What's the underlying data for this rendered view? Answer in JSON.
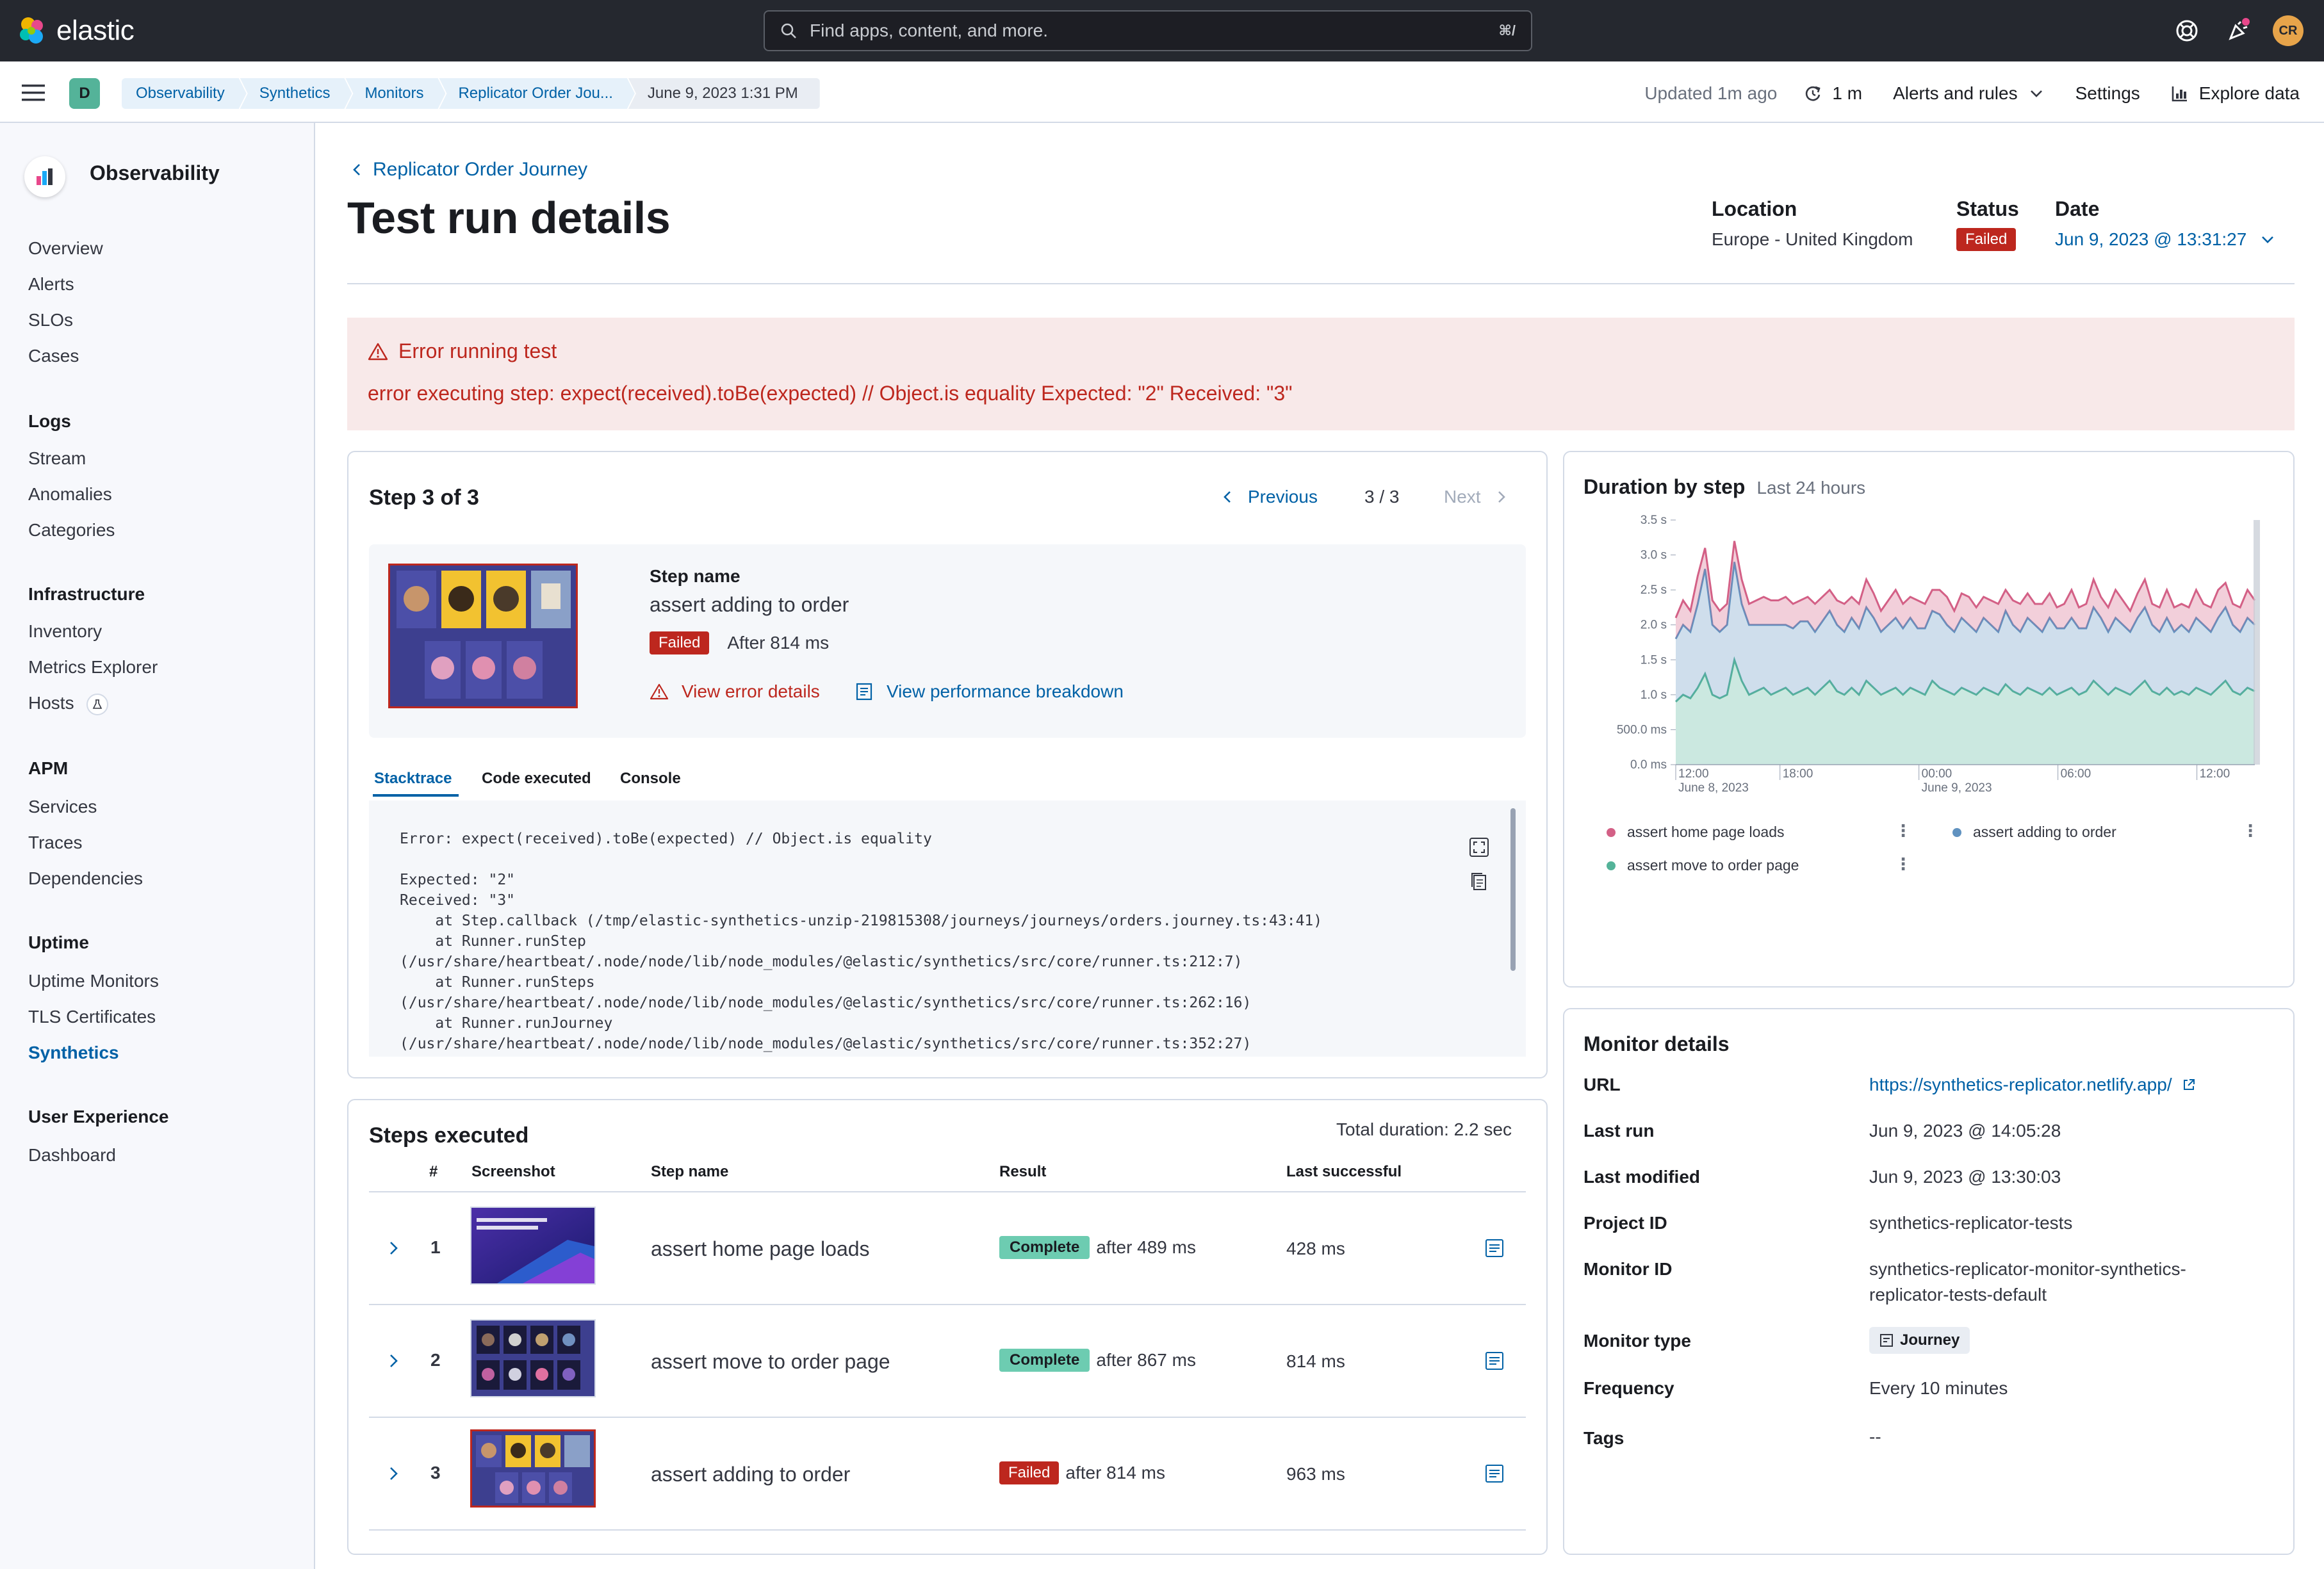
{
  "app": {
    "name": "elastic"
  },
  "search": {
    "placeholder": "Find apps, content, and more.",
    "shortcut": "⌘/"
  },
  "user": {
    "initials": "CR"
  },
  "space": {
    "initial": "D"
  },
  "breadcrumbs": [
    "Observability",
    "Synthetics",
    "Monitors",
    "Replicator Order Jou...",
    "June 9, 2023 1:31 PM"
  ],
  "subbar": {
    "updated": "Updated 1m ago",
    "refresh": "1 m",
    "alerts": "Alerts and rules",
    "settings": "Settings",
    "explore": "Explore data"
  },
  "sidebar": {
    "title": "Observability",
    "top_items": [
      "Overview",
      "Alerts",
      "SLOs",
      "Cases"
    ],
    "groups": [
      {
        "title": "Logs",
        "items": [
          "Stream",
          "Anomalies",
          "Categories"
        ]
      },
      {
        "title": "Infrastructure",
        "items": [
          "Inventory",
          "Metrics Explorer",
          "Hosts"
        ]
      },
      {
        "title": "APM",
        "items": [
          "Services",
          "Traces",
          "Dependencies"
        ]
      },
      {
        "title": "Uptime",
        "items": [
          "Uptime Monitors",
          "TLS Certificates",
          "Synthetics"
        ]
      },
      {
        "title": "User Experience",
        "items": [
          "Dashboard"
        ]
      }
    ],
    "active_item": "Synthetics"
  },
  "header": {
    "back_label": "Replicator Order Journey",
    "title": "Test run details",
    "location_label": "Location",
    "location_value": "Europe - United Kingdom",
    "status_label": "Status",
    "status_value": "Failed",
    "date_label": "Date",
    "date_value": "Jun 9, 2023 @ 13:31:27"
  },
  "error": {
    "title": "Error running test",
    "message": "error executing step: expect(received).toBe(expected) // Object.is equality Expected: \"2\" Received: \"3\""
  },
  "step_panel": {
    "title": "Step 3 of 3",
    "previous": "Previous",
    "pager": "3 / 3",
    "next": "Next",
    "step_name_label": "Step name",
    "step_name": "assert adding to order",
    "status": "Failed",
    "duration": "After 814 ms",
    "view_error": "View error details",
    "view_perf": "View performance breakdown",
    "tabs": [
      "Stacktrace",
      "Code executed",
      "Console"
    ],
    "stacktrace": "Error: expect(received).toBe(expected) // Object.is equality\n\nExpected: \"2\"\nReceived: \"3\"\n    at Step.callback (/tmp/elastic-synthetics-unzip-219815308/journeys/journeys/orders.journey.ts:43:41)\n    at Runner.runStep\n(/usr/share/heartbeat/.node/node/lib/node_modules/@elastic/synthetics/src/core/runner.ts:212:7)\n    at Runner.runSteps\n(/usr/share/heartbeat/.node/node/lib/node_modules/@elastic/synthetics/src/core/runner.ts:262:16)\n    at Runner.runJourney\n(/usr/share/heartbeat/.node/node/lib/node_modules/@elastic/synthetics/src/core/runner.ts:352:27)"
  },
  "duration_panel": {
    "title": "Duration by step",
    "subtitle": "Last 24 hours",
    "legend": [
      "assert home page loads",
      "assert adding to order",
      "assert move to order page"
    ]
  },
  "chart_data": {
    "type": "area",
    "title": "Duration by step",
    "subtitle": "Last 24 hours",
    "xlabel": "",
    "ylabel": "",
    "x_ticks": [
      "12:00\nJune 8, 2023",
      "18:00",
      "00:00\nJune 9, 2023",
      "06:00",
      "12:00"
    ],
    "y_ticks": [
      "0.0 ms",
      "500.0 ms",
      "1.0 s",
      "1.5 s",
      "2.0 s",
      "2.5 s",
      "3.0 s",
      "3.5 s"
    ],
    "ylim": [
      0,
      3.5
    ],
    "stacked": true,
    "series": [
      {
        "name": "assert move to order page",
        "color": "#54b399",
        "values": [
          0.9,
          1.0,
          0.95,
          1.1,
          1.3,
          1.0,
          0.95,
          1.0,
          1.5,
          1.2,
          1.0,
          1.05,
          1.1,
          1.0,
          1.05,
          1.1,
          1.0,
          1.05,
          1.1,
          1.0,
          1.1,
          1.2,
          1.05,
          1.0,
          1.1,
          1.0,
          1.2,
          1.1,
          1.0,
          1.05,
          1.1,
          1.0,
          1.1,
          1.05,
          1.0,
          1.2,
          1.1,
          1.05,
          1.0,
          1.1,
          1.05,
          1.0,
          1.1,
          1.05,
          1.0,
          1.15,
          1.05,
          1.0,
          1.1,
          1.05,
          1.0,
          1.1,
          1.0,
          1.05,
          1.1,
          1.0,
          1.05,
          1.2,
          1.1,
          1.0,
          1.1,
          1.05,
          1.0,
          1.1,
          1.2,
          1.05,
          1.0,
          1.1,
          1.0,
          1.05,
          1.0,
          1.1,
          1.05,
          1.0,
          1.1,
          1.2,
          1.05,
          1.0,
          1.1,
          1.05
        ]
      },
      {
        "name": "assert adding to order",
        "color": "#6092c0",
        "values": [
          0.9,
          1.0,
          0.95,
          1.2,
          1.5,
          1.0,
          0.95,
          1.0,
          1.4,
          1.1,
          1.0,
          0.95,
          0.9,
          1.0,
          0.95,
          0.9,
          0.95,
          1.0,
          0.95,
          0.9,
          0.95,
          1.0,
          0.95,
          0.9,
          1.0,
          0.95,
          1.05,
          1.0,
          0.9,
          0.95,
          1.0,
          0.95,
          1.0,
          0.9,
          0.95,
          1.0,
          1.05,
          0.95,
          0.9,
          1.0,
          0.95,
          0.9,
          1.0,
          0.95,
          0.9,
          1.05,
          0.95,
          0.9,
          1.0,
          0.95,
          0.9,
          1.0,
          0.95,
          0.9,
          1.0,
          0.95,
          0.9,
          1.05,
          1.0,
          0.9,
          1.0,
          0.95,
          0.9,
          1.0,
          1.05,
          0.95,
          0.9,
          1.0,
          0.9,
          0.95,
          0.9,
          1.0,
          0.95,
          0.9,
          1.0,
          1.05,
          0.95,
          0.9,
          1.0,
          0.95
        ]
      },
      {
        "name": "assert home page loads",
        "color": "#d36086",
        "values": [
          0.3,
          0.35,
          0.3,
          0.4,
          0.3,
          0.35,
          0.3,
          0.3,
          0.3,
          0.35,
          0.3,
          0.35,
          0.4,
          0.35,
          0.35,
          0.4,
          0.35,
          0.3,
          0.35,
          0.4,
          0.35,
          0.3,
          0.35,
          0.4,
          0.3,
          0.35,
          0.4,
          0.35,
          0.3,
          0.35,
          0.4,
          0.35,
          0.3,
          0.4,
          0.35,
          0.3,
          0.35,
          0.4,
          0.3,
          0.35,
          0.4,
          0.35,
          0.3,
          0.35,
          0.4,
          0.3,
          0.35,
          0.4,
          0.35,
          0.3,
          0.4,
          0.35,
          0.3,
          0.35,
          0.4,
          0.3,
          0.35,
          0.4,
          0.3,
          0.35,
          0.4,
          0.35,
          0.3,
          0.35,
          0.4,
          0.3,
          0.35,
          0.4,
          0.35,
          0.3,
          0.35,
          0.4,
          0.3,
          0.35,
          0.4,
          0.35,
          0.3,
          0.35,
          0.4,
          0.35
        ]
      }
    ]
  },
  "steps_panel": {
    "title": "Steps executed",
    "total_duration": "Total duration: 2.2 sec",
    "columns": [
      "#",
      "Screenshot",
      "Step name",
      "Result",
      "Last successful"
    ],
    "rows": [
      {
        "num": "1",
        "name": "assert home page loads",
        "result": "Complete",
        "after": "after 489 ms",
        "last": "428 ms"
      },
      {
        "num": "2",
        "name": "assert move to order page",
        "result": "Complete",
        "after": "after 867 ms",
        "last": "814 ms"
      },
      {
        "num": "3",
        "name": "assert adding to order",
        "result": "Failed",
        "after": "after 814 ms",
        "last": "963 ms"
      }
    ]
  },
  "monitor_details": {
    "title": "Monitor details",
    "url_label": "URL",
    "url": "https://synthetics-replicator.netlify.app/",
    "last_run_label": "Last run",
    "last_run": "Jun 9, 2023 @ 14:05:28",
    "last_modified_label": "Last modified",
    "last_modified": "Jun 9, 2023 @ 13:30:03",
    "project_id_label": "Project ID",
    "project_id": "synthetics-replicator-tests",
    "monitor_id_label": "Monitor ID",
    "monitor_id_1": "synthetics-replicator-monitor-synthetics-",
    "monitor_id_2": "replicator-tests-default",
    "monitor_type_label": "Monitor type",
    "monitor_type": "Journey",
    "frequency_label": "Frequency",
    "frequency": "Every 10 minutes",
    "tags_label": "Tags",
    "tags": "--"
  }
}
